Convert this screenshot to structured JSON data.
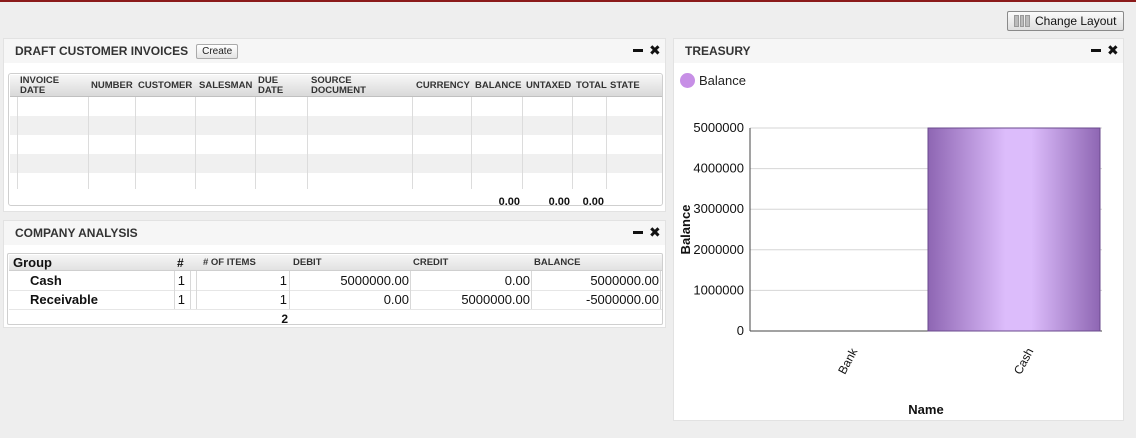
{
  "toolbar": {
    "change_layout_label": "Change Layout"
  },
  "invoices": {
    "title": "Draft Customer Invoices",
    "create_label": "Create",
    "columns": [
      "INVOICE DATE",
      "NUMBER",
      "CUSTOMER",
      "SALESMAN",
      "DUE DATE",
      "SOURCE DOCUMENT",
      "CURRENCY",
      "BALANCE",
      "UNTAXED",
      "TOTAL",
      "STATE"
    ],
    "totals": {
      "balance": "0.00",
      "untaxed": "0.00",
      "total": "0.00"
    }
  },
  "analysis": {
    "title": "Company Analysis",
    "columns": {
      "group": "Group",
      "hash": "#",
      "items": "# OF ITEMS",
      "debit": "DEBIT",
      "credit": "CREDIT",
      "balance": "BALANCE"
    },
    "rows": [
      {
        "name": "Cash",
        "hash": "1",
        "items": "1",
        "debit": "5000000.00",
        "credit": "0.00",
        "balance": "5000000.00"
      },
      {
        "name": "Receivable",
        "hash": "1",
        "items": "1",
        "debit": "0.00",
        "credit": "5000000.00",
        "balance": "-5000000.00"
      }
    ],
    "total_items": "2"
  },
  "treasury": {
    "title": "Treasury",
    "legend_label": "Balance"
  },
  "chart_data": {
    "type": "bar",
    "categories": [
      "Bank",
      "Cash"
    ],
    "series": [
      {
        "name": "Balance",
        "values": [
          0,
          5000000
        ]
      }
    ],
    "xlabel": "Name",
    "ylabel": "Balance",
    "ylim": [
      0,
      5000000
    ],
    "yticks": [
      "0",
      "1000000",
      "2000000",
      "3000000",
      "4000000",
      "5000000"
    ],
    "grid": true,
    "legend_position": "top-left",
    "bar_color": "#c78fe6"
  }
}
